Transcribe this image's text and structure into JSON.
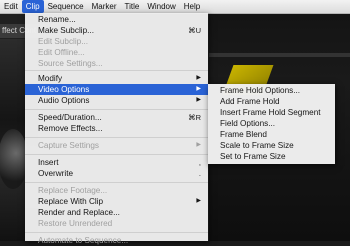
{
  "menubar": {
    "items": [
      "Edit",
      "Clip",
      "Sequence",
      "Marker",
      "Title",
      "Window",
      "Help"
    ],
    "active": "Clip"
  },
  "background": {
    "panel_tab": "ffect Cont"
  },
  "clip_menu": {
    "items": [
      {
        "label": "Rename...",
        "enabled": true
      },
      {
        "label": "Make Subclip...",
        "shortcut": "⌘U",
        "enabled": true
      },
      {
        "label": "Edit Subclip...",
        "enabled": false
      },
      {
        "label": "Edit Offline...",
        "enabled": false
      },
      {
        "label": "Source Settings...",
        "enabled": false
      },
      {
        "label": "Modify",
        "submenu": true,
        "enabled": true
      },
      {
        "label": "Video Options",
        "submenu": true,
        "enabled": true,
        "highlighted": true
      },
      {
        "label": "Audio Options",
        "submenu": true,
        "enabled": true
      },
      {
        "label": "Speed/Duration...",
        "shortcut": "⌘R",
        "enabled": true
      },
      {
        "label": "Remove Effects...",
        "enabled": true
      },
      {
        "label": "Capture Settings",
        "submenu": true,
        "enabled": false
      },
      {
        "label": "Insert",
        "shortcut": ",",
        "enabled": true
      },
      {
        "label": "Overwrite",
        "shortcut": ".",
        "enabled": true
      },
      {
        "label": "Replace Footage...",
        "enabled": false
      },
      {
        "label": "Replace With Clip",
        "submenu": true,
        "enabled": true
      },
      {
        "label": "Render and Replace...",
        "enabled": true
      },
      {
        "label": "Restore Unrendered",
        "enabled": false
      },
      {
        "label": "Automate to Sequence...",
        "enabled": false
      }
    ]
  },
  "video_options_submenu": {
    "items": [
      "Frame Hold Options...",
      "Add Frame Hold",
      "Insert Frame Hold Segment",
      "Field Options...",
      "Frame Blend",
      "Scale to Frame Size",
      "Set to Frame Size"
    ]
  },
  "colors": {
    "highlight": "#2a63d6",
    "menu_bg": "#eeeeee",
    "disabled_text": "#a0a0a0"
  }
}
